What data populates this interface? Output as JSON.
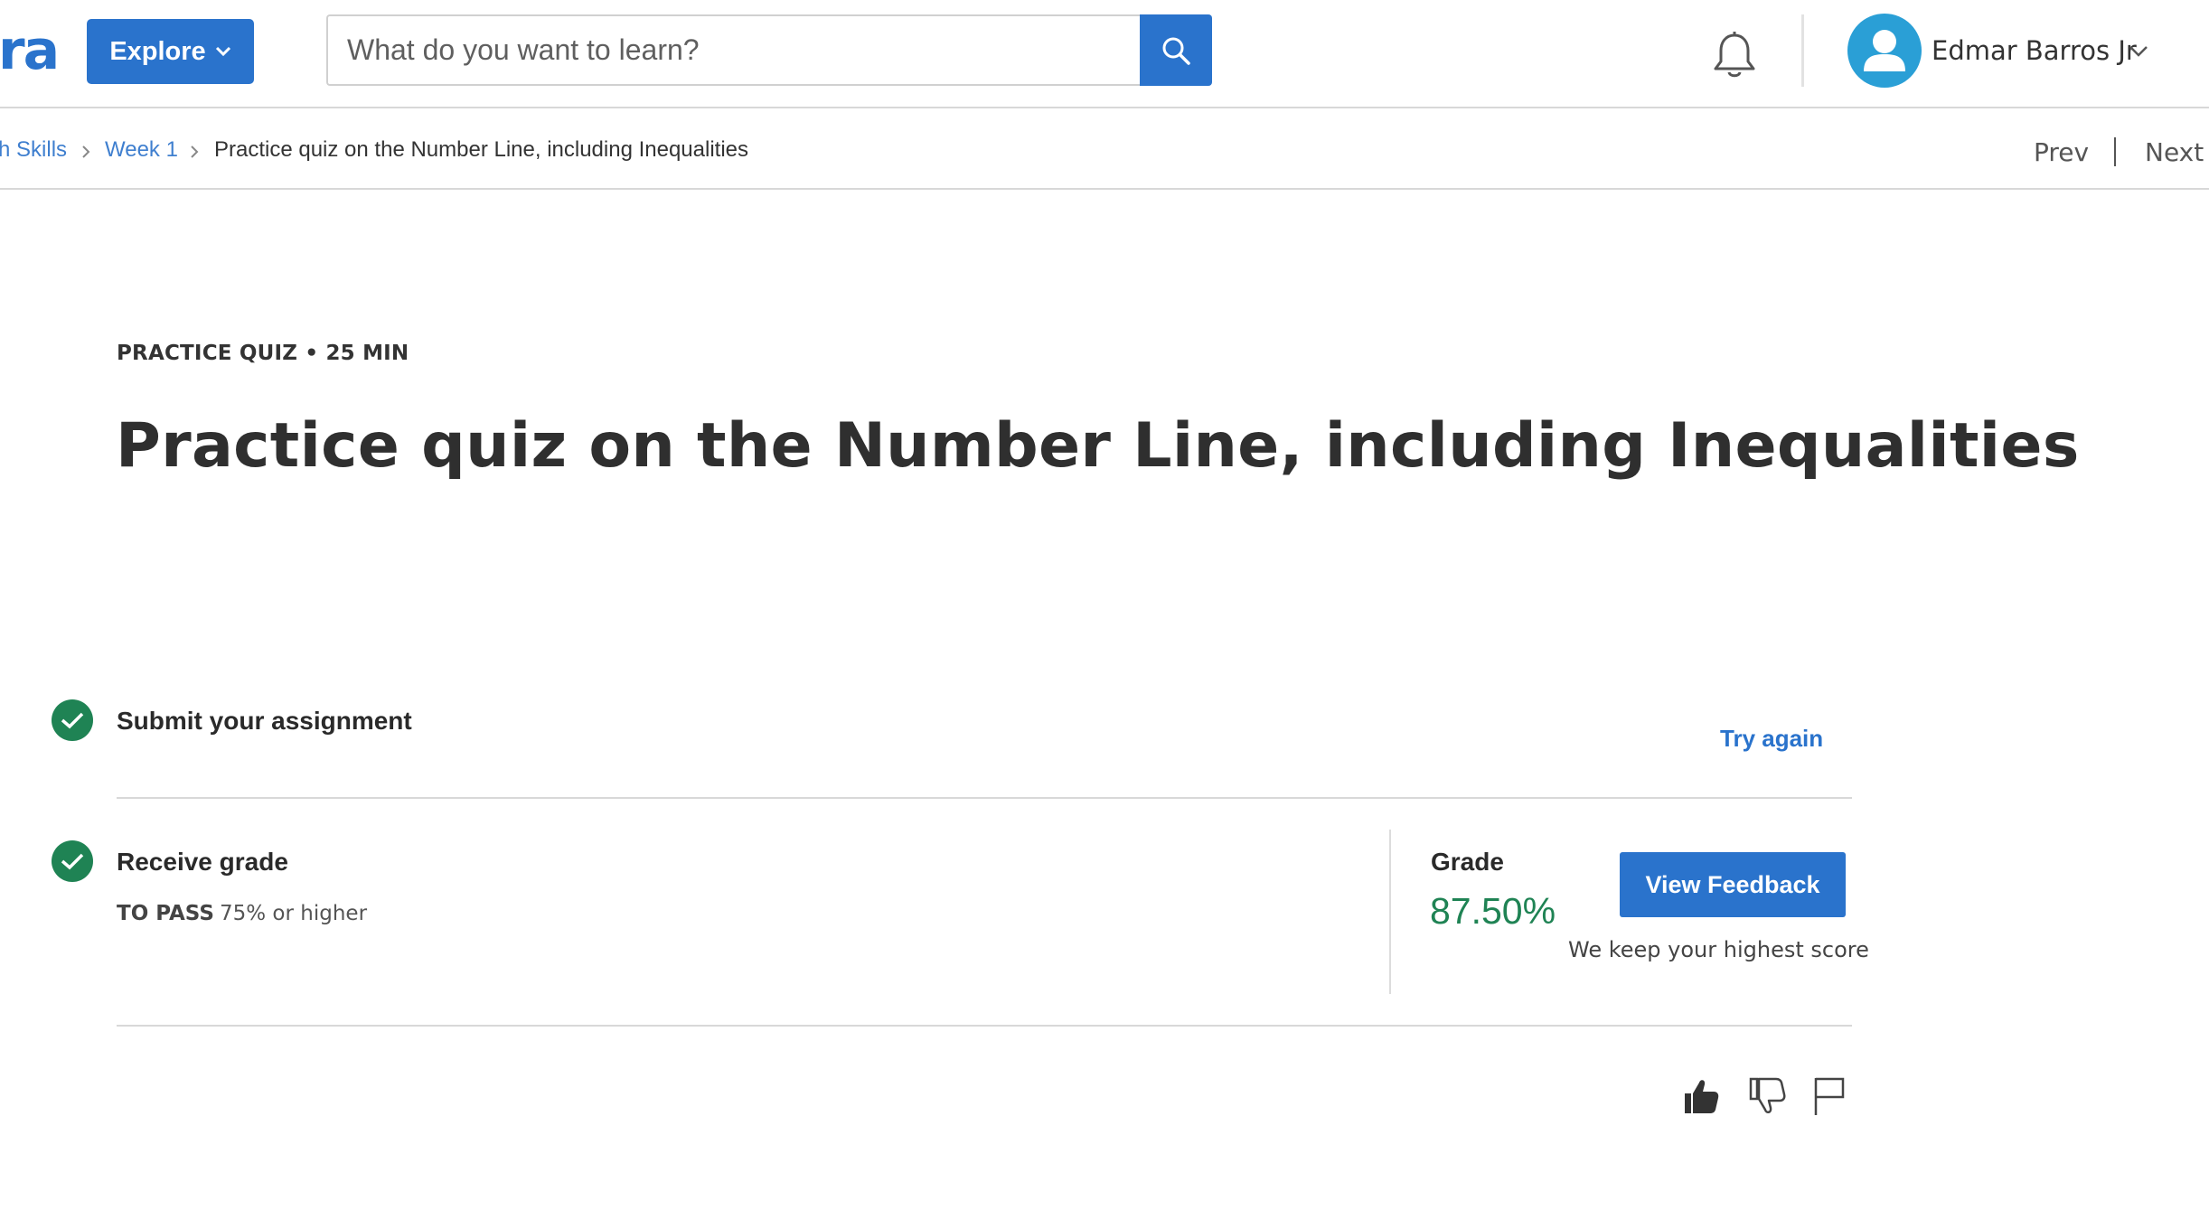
{
  "header": {
    "logo_text": "ra",
    "explore_label": "Explore",
    "search_placeholder": "What do you want to learn?",
    "user_name": "Edmar Barros Jr"
  },
  "breadcrumb": {
    "items": [
      "h Skills",
      "Week 1",
      "Practice quiz on the Number Line, including Inequalities"
    ],
    "prev_label": "Prev",
    "next_label": "Next"
  },
  "quiz": {
    "meta": "PRACTICE QUIZ • 25 MIN",
    "title": "Practice quiz on the Number Line, including Inequalities"
  },
  "steps": {
    "submit": {
      "title": "Submit your assignment",
      "action_label": "Try again"
    },
    "grade": {
      "title": "Receive grade",
      "to_pass_label": "TO PASS",
      "to_pass_value": "75% or higher",
      "grade_label": "Grade",
      "grade_value": "87.50%",
      "feedback_button": "View Feedback",
      "note": "We keep your highest score"
    }
  },
  "colors": {
    "brand_blue": "#2a73cc",
    "success_green": "#1f8354",
    "link_blue": "#3f7fcf"
  },
  "icons": {
    "search": "search-icon",
    "bell": "bell-icon",
    "avatar": "user-avatar-icon",
    "like": "thumbs-up-icon",
    "dislike": "thumbs-down-icon",
    "flag": "flag-icon"
  }
}
